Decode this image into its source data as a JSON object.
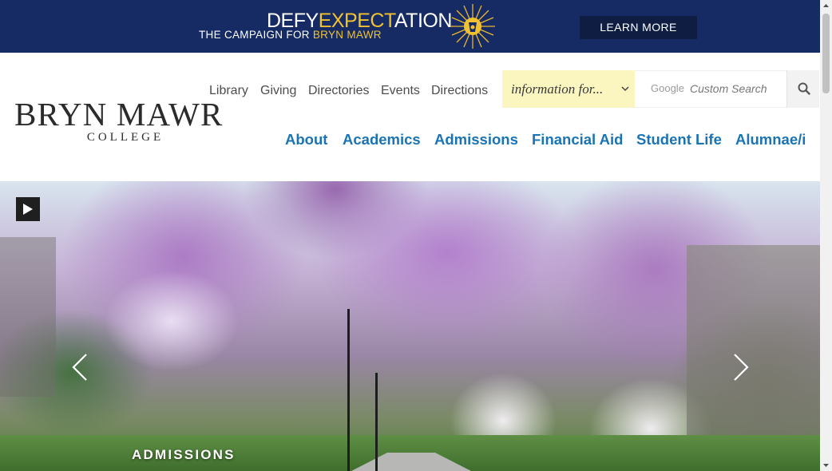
{
  "banner": {
    "defy": "DEFY",
    "expect": "EXPECT",
    "ation": "ATION",
    "campaign_prefix": "THE CAMPAIGN FOR ",
    "campaign_name": "BRYN MAWR",
    "learn_more_label": "LEARN MORE",
    "burst_icon": "lantern-burst-icon",
    "colors": {
      "background": "#162b64",
      "accent": "#f0c231",
      "button": "#0f1d43"
    }
  },
  "logo": {
    "name": "BRYN MAWR",
    "sub": "COLLEGE"
  },
  "utility_nav": {
    "items": [
      {
        "label": "Library"
      },
      {
        "label": "Giving"
      },
      {
        "label": "Directories"
      },
      {
        "label": "Events"
      },
      {
        "label": "Directions"
      }
    ],
    "information_for": {
      "label": "information for...",
      "icon": "chevron-down-icon",
      "background": "#fbf5c0"
    }
  },
  "search": {
    "provider_label": "Google",
    "placeholder": "Custom Search",
    "icon": "search-icon"
  },
  "main_nav": {
    "items": [
      {
        "label": "About"
      },
      {
        "label": "Academics"
      },
      {
        "label": "Admissions"
      },
      {
        "label": "Financial Aid"
      },
      {
        "label": "Student Life"
      },
      {
        "label": "Alumnae/i"
      }
    ],
    "color": "#1a74b4"
  },
  "hero": {
    "slide_label": "ADMISSIONS",
    "play_icon": "play-icon",
    "prev_icon": "chevron-left-icon",
    "next_icon": "chevron-right-icon"
  }
}
